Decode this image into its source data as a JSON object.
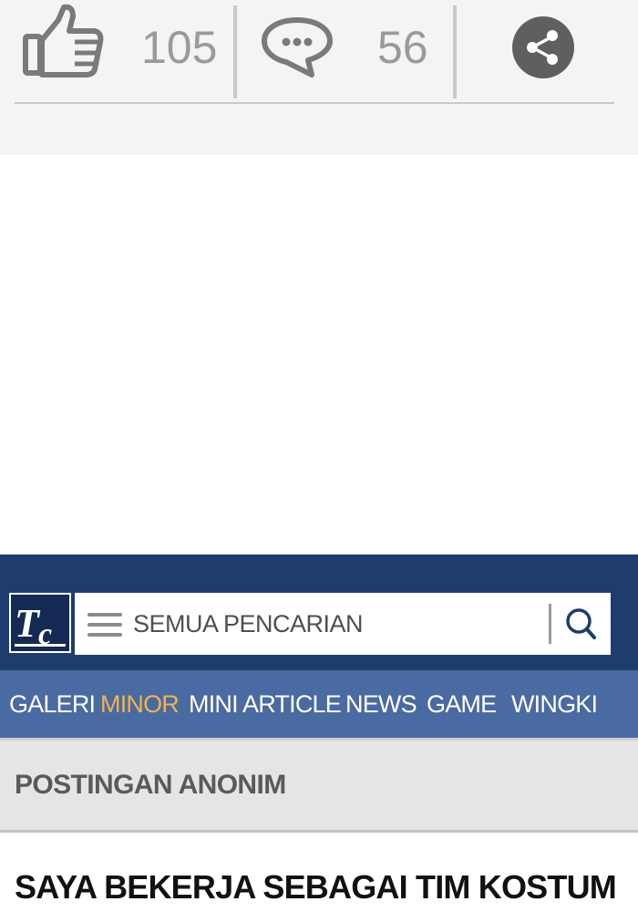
{
  "reactions": {
    "like_count": "105",
    "comment_count": "56"
  },
  "icons": {
    "like": "thumbs-up-icon",
    "comment": "speech-bubble-icon",
    "share": "share-icon",
    "menu": "hamburger-menu-icon",
    "search": "search-icon"
  },
  "header": {
    "logo_text": "TC",
    "search_placeholder": "SEMUA PENCARIAN"
  },
  "nav": {
    "items": [
      {
        "label": "GALERI",
        "active": false
      },
      {
        "label": "MINOR",
        "active": true
      },
      {
        "label": "MINI ARTICLE",
        "active": false
      },
      {
        "label": "NEWS",
        "active": false
      },
      {
        "label": "GAME",
        "active": false
      },
      {
        "label": "WINGKI",
        "active": false
      }
    ]
  },
  "section": {
    "title": "POSTINGAN ANONIM"
  },
  "article": {
    "title": "SAYA BEKERJA SEBAGAI TIM KOSTUM"
  },
  "colors": {
    "header_bg": "#1f3c6e",
    "nav_bg": "#4a6aa2",
    "nav_active": "#f0b34e",
    "share_button": "#5f5f5f"
  }
}
